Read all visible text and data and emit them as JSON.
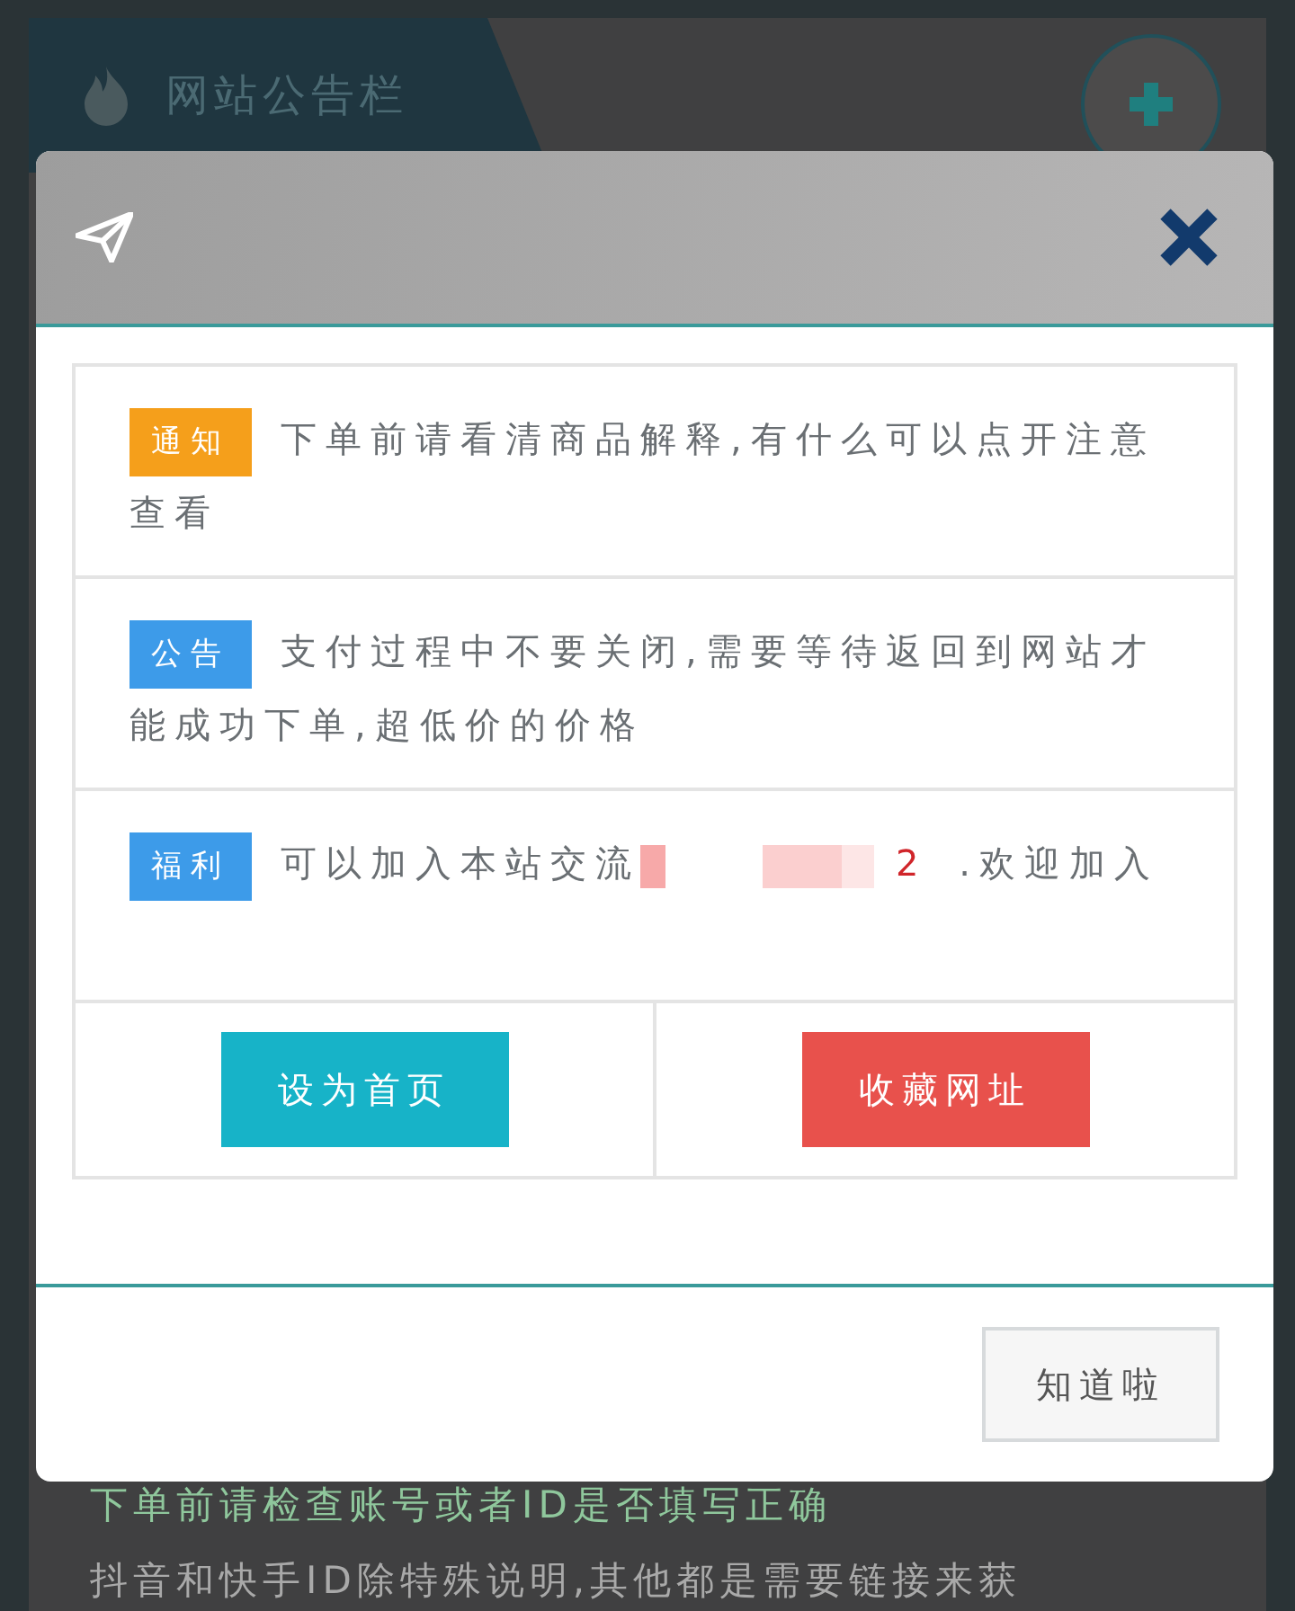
{
  "background_page": {
    "title": "网站公告栏",
    "lines": [
      "下单前请检查账号或者ID是否填写正确",
      "抖音和快手ID除特殊说明,其他都是需要链接来获"
    ]
  },
  "modal": {
    "notices": [
      {
        "tag": "通知",
        "color": "#f59f1b",
        "parts": [
          {
            "kind": "text",
            "text": "下单前请看清商品解释,有什么可以点开注意查看"
          }
        ]
      },
      {
        "tag": "公告",
        "color": "#3d9be9",
        "parts": [
          {
            "kind": "text",
            "text": "支付过程中不要关闭,需要等待返回到网站才能成功下单,超低价的价格"
          }
        ]
      },
      {
        "tag": "福利",
        "color": "#3d9be9",
        "parts": [
          {
            "kind": "text",
            "text": "可以加入本站交流"
          },
          {
            "kind": "redacted"
          },
          {
            "kind": "number",
            "text": "2"
          },
          {
            "kind": "text",
            "text": " .欢迎加入"
          }
        ]
      }
    ],
    "actions": [
      {
        "label": "设为首页",
        "color": "#17b3c8"
      },
      {
        "label": "收藏网址",
        "color": "#e8514c"
      }
    ],
    "footer_button": "知道啦"
  }
}
